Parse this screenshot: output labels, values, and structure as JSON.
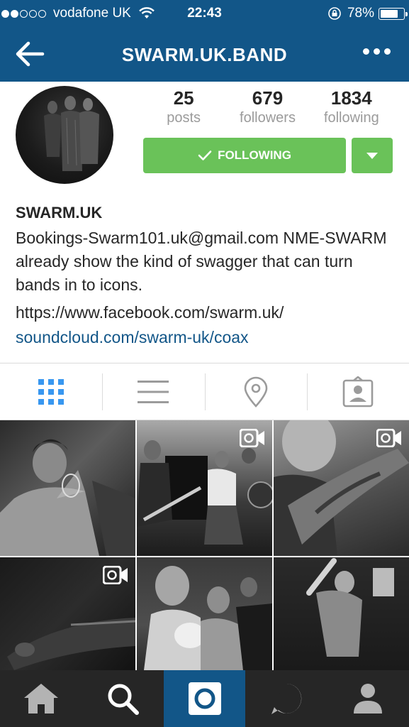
{
  "status_bar": {
    "carrier": "vodafone UK",
    "time": "22:43",
    "battery": "78%",
    "battery_level": 0.78,
    "signal_bars": 2
  },
  "nav": {
    "title": "SWARM.UK.BAND"
  },
  "profile": {
    "stats": [
      {
        "value": "25",
        "label": "posts"
      },
      {
        "value": "679",
        "label": "followers"
      },
      {
        "value": "1834",
        "label": "following"
      }
    ],
    "follow_label": "FOLLOWING",
    "name": "SWARM.UK",
    "bio": "Bookings-Swarm101.uk@gmail.com NME-SWARM already show the kind of swagger that can turn bands in to icons.",
    "link1": "https://www.facebook.com/swarm.uk/",
    "link2": "soundcloud.com/swarm-uk/coax"
  },
  "colors": {
    "brand": "#125688",
    "follow_green": "#6ac259",
    "active_tab": "#3897f0",
    "tabbar": "#262626"
  },
  "view_tabs": [
    "grid-icon",
    "list-icon",
    "location-pin-icon",
    "tagged-photo-icon"
  ],
  "posts": [
    {
      "is_video": false
    },
    {
      "is_video": true
    },
    {
      "is_video": true
    },
    {
      "is_video": true
    },
    {
      "is_video": false
    },
    {
      "is_video": false
    }
  ],
  "bottom_tabs": [
    "home-icon",
    "search-icon",
    "camera-icon",
    "activity-icon",
    "profile-icon"
  ]
}
